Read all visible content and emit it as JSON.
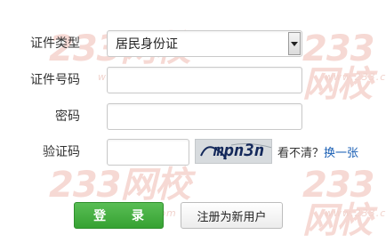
{
  "watermark": {
    "brand": "233网校",
    "url": "www.233.com"
  },
  "form": {
    "id_type_label": "证件类型",
    "id_type_value": "居民身份证",
    "id_number_label": "证件号码",
    "id_number_value": "",
    "password_label": "密码",
    "password_value": "",
    "captcha_label": "验证码",
    "captcha_value": "",
    "captcha_image_text": "mpn3n",
    "captcha_hint": "看不清？",
    "captcha_refresh": "换一张"
  },
  "buttons": {
    "login": "登 录",
    "register": "注册为新用户"
  }
}
